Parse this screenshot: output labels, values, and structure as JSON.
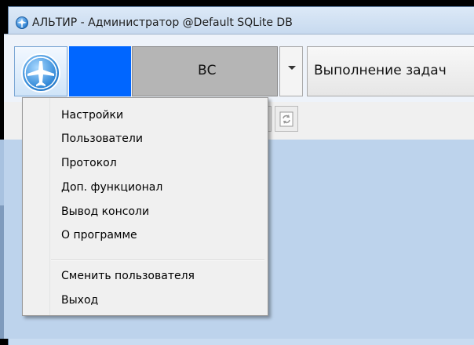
{
  "window": {
    "title": "АЛЬТИР - Администратор @Default SQLite DB"
  },
  "toolbar": {
    "logo_icon": "airplane-globe-icon",
    "vs_label": "ВС",
    "tasks_label": "Выполнение задач",
    "vs_dropdown_icon": "chevron-down-icon",
    "refresh_icon": "refresh-icon"
  },
  "menu": {
    "items": [
      {
        "label": "Настройки"
      },
      {
        "label": "Пользователи"
      },
      {
        "label": "Протокол"
      },
      {
        "label": "Доп. функционал"
      },
      {
        "label": "Вывод консоли"
      },
      {
        "label": "О программе"
      },
      {
        "label": "Сменить пользователя"
      },
      {
        "label": "Выход"
      }
    ]
  },
  "colors": {
    "accent_blue": "#0066ff",
    "workspace": "#bdd3ec",
    "vs_block": "#b5b5b5",
    "menu_bg": "#f0f0f0"
  }
}
